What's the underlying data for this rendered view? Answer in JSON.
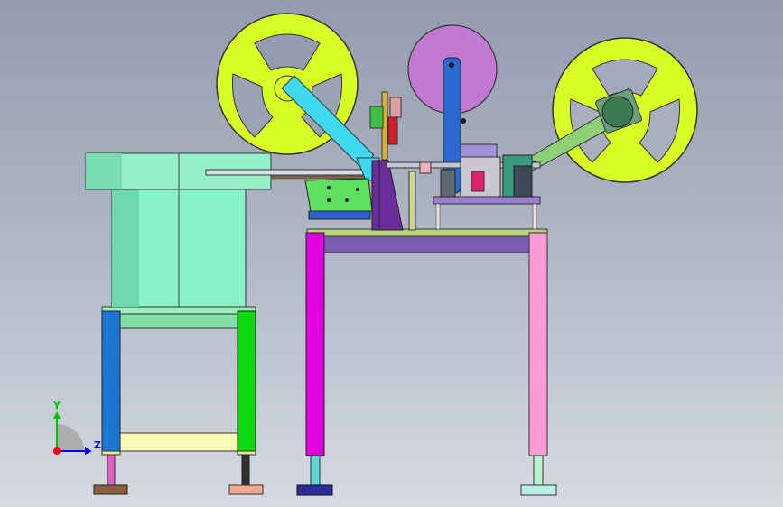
{
  "view": {
    "triad": {
      "y_label": "Y",
      "z_label": "Z",
      "y_color": "#00c000",
      "z_color": "#0000ff",
      "origin_color": "#ff0000"
    }
  },
  "colors": {
    "background_top": "#939cae",
    "background_bottom": "#d6dae2",
    "reel": "#d8ff26",
    "reel_hub": "#c07ad0",
    "feeder_bowl": "#8ff0c8",
    "table_top_rail": "#7a5db0",
    "table_leg_left": "#e000e0",
    "table_leg_right": "#ff9ad6",
    "stand_leg_left": "#1a76d0",
    "stand_leg_right": "#12d812",
    "stand_crossbar": "#fafab4",
    "arm_left": "#40d8f0",
    "arm_right": "#90d078",
    "motor": "#3c7a50"
  }
}
